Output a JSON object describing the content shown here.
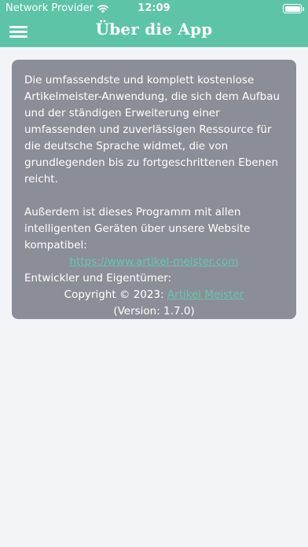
{
  "status_bar": {
    "carrier": "Network Provider",
    "time": "12:09"
  },
  "header": {
    "title": "Über die App",
    "background_color": "#5dc4a7"
  },
  "card": {
    "intro": "Die umfassendste und komplett kostenlose Artikelmeister-Anwendung, die sich dem Aufbau und der ständigen Erweiterung einer umfassenden und zuverlässigen Ressource für die deutsche Sprache widmet, die von grundlegenden bis zu fortgeschrittenen Ebenen reicht.",
    "compat": "Außerdem ist dieses Programm mit allen intelligenten Geräten über unsere Website kompatibel:",
    "website_link": "https://www.artikel-meister.com",
    "developer_label": "Entwickler und Eigentümer:",
    "copyright_prefix": "Copyright © 2023:",
    "owner_link": "Artikel Meister",
    "version": "(Version: 1.7.0)",
    "background_color": "#8b8e96",
    "link_color": "#67c7ad"
  }
}
